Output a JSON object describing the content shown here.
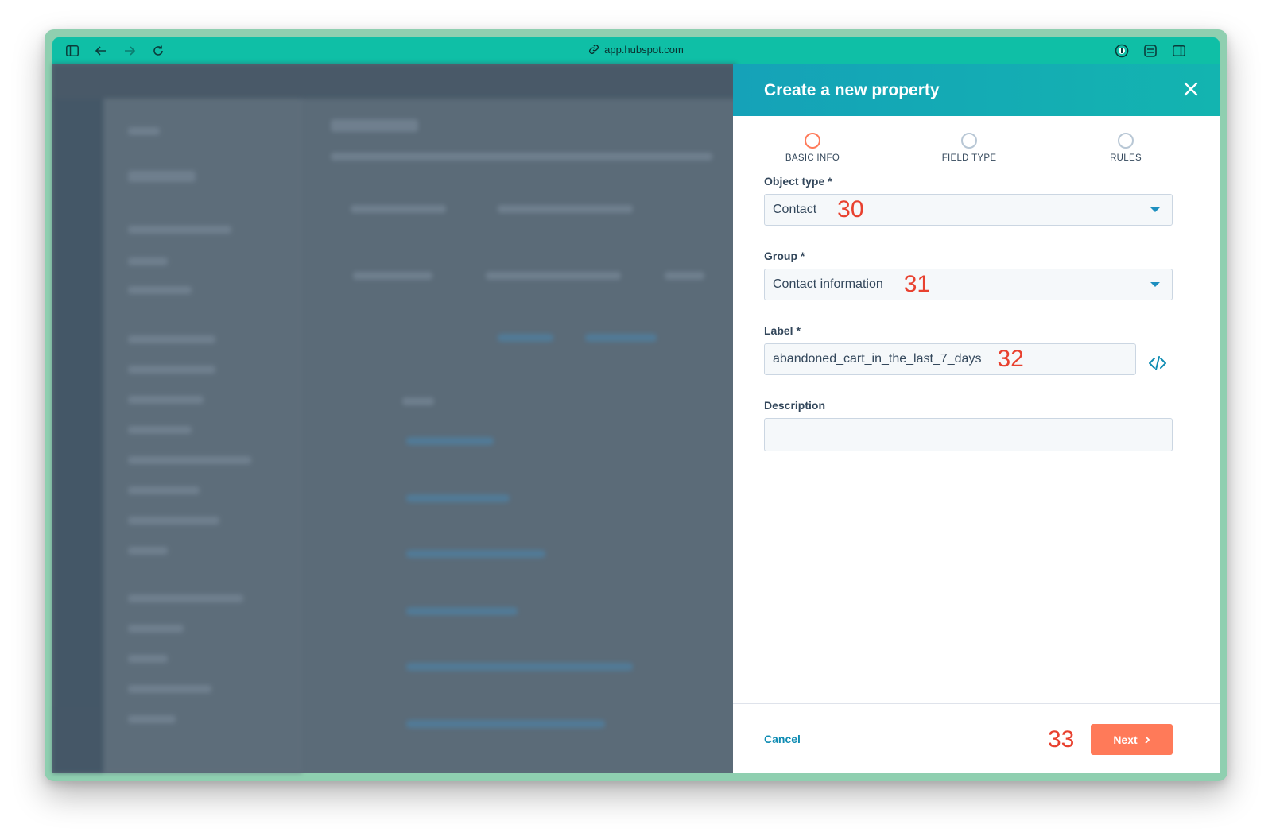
{
  "browser": {
    "url": "app.hubspot.com",
    "icons": [
      "sidebar-toggle-icon",
      "back-arrow-icon",
      "forward-arrow-icon",
      "reload-icon",
      "link-icon",
      "password-manager-icon",
      "extension-icon",
      "split-view-icon"
    ]
  },
  "modal": {
    "title": "Create a new property",
    "steps": [
      {
        "label": "BASIC INFO",
        "active": true
      },
      {
        "label": "FIELD TYPE",
        "active": false
      },
      {
        "label": "RULES",
        "active": false
      }
    ],
    "fields": {
      "object_type": {
        "label": "Object type *",
        "value": "Contact",
        "annotation": "30"
      },
      "group": {
        "label": "Group *",
        "value": "Contact information",
        "annotation": "31"
      },
      "label": {
        "label": "Label *",
        "value": "abandoned_cart_in_the_last_7_days",
        "annotation": "32"
      },
      "description": {
        "label": "Description",
        "value": ""
      }
    },
    "footer": {
      "cancel_label": "Cancel",
      "next_label": "Next",
      "annotation": "33"
    }
  },
  "colors": {
    "browser_bar": "#0fbfa6",
    "header_gradient_start": "#15a2b8",
    "accent_link": "#0f8cb3",
    "primary_button": "#ff7a59",
    "active_step": "#ff7a59",
    "annotation": "#e8412f"
  }
}
